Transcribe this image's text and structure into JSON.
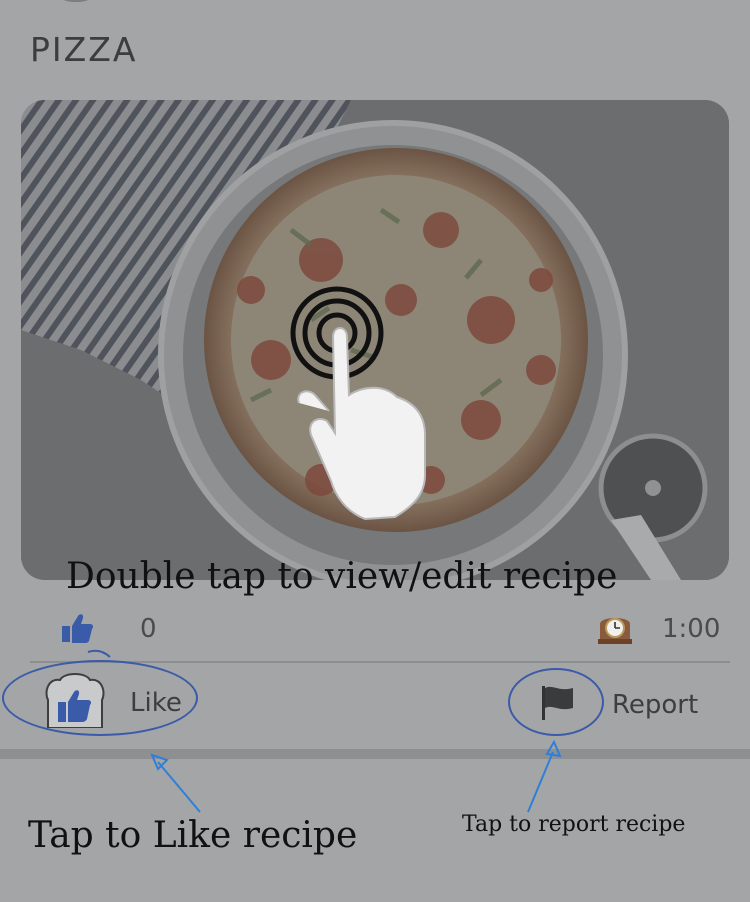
{
  "recipe": {
    "title": "PIZZA",
    "like_count": "0",
    "duration": "1:00"
  },
  "actions": {
    "like_label": "Like",
    "report_label": "Report"
  },
  "hints": {
    "view_edit": "Double tap to view/edit recipe",
    "like": "Tap to Like recipe",
    "report": "Tap to report recipe"
  },
  "icons": {
    "like_count": "thumbs-up-icon",
    "duration": "clock-icon",
    "like_button": "thumbs-up-icon",
    "report_button": "flag-icon",
    "gesture": "double-tap-hand-icon"
  },
  "colors": {
    "overlay_background": "#a4a5a7",
    "annotation_blue": "#3a5ba8",
    "hint_text": "#111111"
  }
}
